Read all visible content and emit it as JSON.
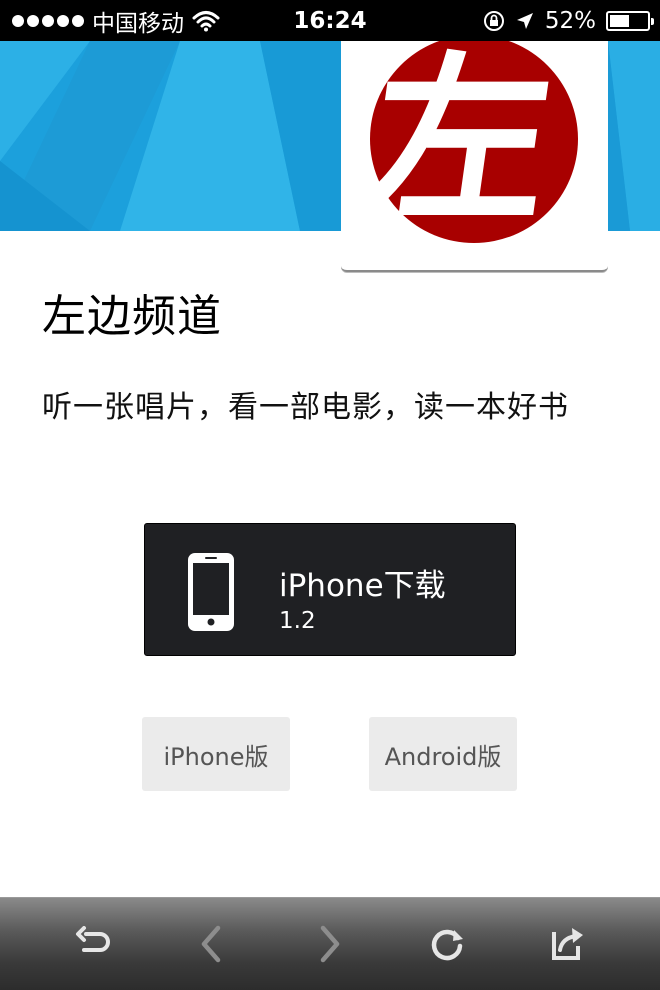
{
  "status_bar": {
    "carrier": "中国移动",
    "time": "16:24",
    "battery_percent_label": "52%",
    "battery_level": 0.52,
    "icons": [
      "signal-dots-icon",
      "wifi-icon",
      "rotation-lock-icon",
      "location-arrow-icon",
      "battery-icon"
    ]
  },
  "app": {
    "icon_glyph": "左",
    "title": "左边频道",
    "tagline": "听一张唱片，看一部电影，读一本好书"
  },
  "download_button": {
    "title": "iPhone下载",
    "version": "1.2",
    "icon": "iphone-icon"
  },
  "platform_buttons": {
    "iphone_label": "iPhone版",
    "android_label": "Android版"
  },
  "toolbar": {
    "icons": [
      "undo-icon",
      "back-chevron-icon",
      "forward-chevron-icon",
      "reload-icon",
      "share-icon"
    ]
  },
  "colors": {
    "banner": "#1ca0dc",
    "logo_red": "#a80000",
    "download_bg": "#1f2023",
    "secondary_bg": "#ebebeb"
  }
}
